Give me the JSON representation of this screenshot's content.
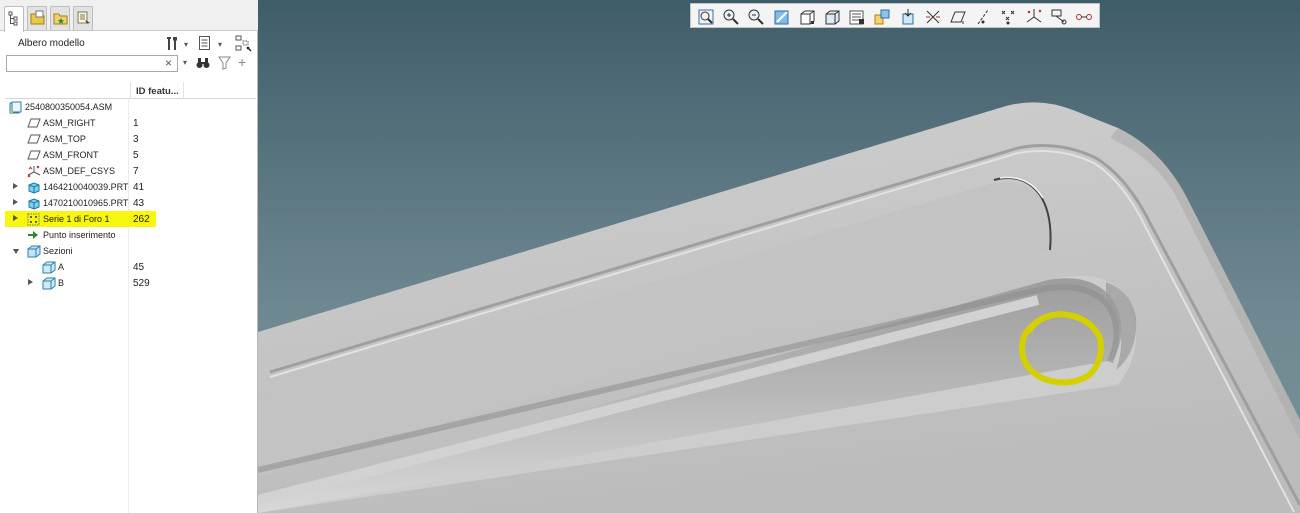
{
  "panel": {
    "tabs": [
      "model-tree-tab",
      "folder-browser-tab",
      "favorites-tab",
      "layers-tab"
    ],
    "title": "Albero modello",
    "search": {
      "value": "",
      "clear_glyph": "×"
    },
    "columns": {
      "name": "",
      "id": "ID featu..."
    }
  },
  "tree": [
    {
      "label": "2540800350054.ASM",
      "id": "",
      "icon": "assembly-icon",
      "indent": 0,
      "arrow": "none"
    },
    {
      "label": "ASM_RIGHT",
      "id": "1",
      "icon": "datum-plane-icon",
      "indent": 1,
      "arrow": "none"
    },
    {
      "label": "ASM_TOP",
      "id": "3",
      "icon": "datum-plane-icon",
      "indent": 1,
      "arrow": "none"
    },
    {
      "label": "ASM_FRONT",
      "id": "5",
      "icon": "datum-plane-icon",
      "indent": 1,
      "arrow": "none"
    },
    {
      "label": "ASM_DEF_CSYS",
      "id": "7",
      "icon": "csys-icon",
      "indent": 1,
      "arrow": "none"
    },
    {
      "label": "1464210040039.PRT",
      "id": "41",
      "icon": "part-icon",
      "indent": 1,
      "arrow": "right"
    },
    {
      "label": "1470210010965.PRT",
      "id": "43",
      "icon": "part-icon",
      "indent": 1,
      "arrow": "right"
    },
    {
      "label": "Serie 1 di Foro 1",
      "id": "262",
      "icon": "pattern-icon",
      "indent": 1,
      "arrow": "right",
      "highlight": true
    },
    {
      "label": "Punto inserimento",
      "id": "",
      "icon": "insert-arrow-icon",
      "indent": 1,
      "arrow": "none"
    },
    {
      "label": "Sezioni",
      "id": "",
      "icon": "sections-icon",
      "indent": 1,
      "arrow": "down"
    },
    {
      "label": "A",
      "id": "45",
      "icon": "section-icon",
      "indent": 2,
      "arrow": "none"
    },
    {
      "label": "B",
      "id": "529",
      "icon": "section-icon",
      "indent": 2,
      "arrow": "right"
    }
  ],
  "toolbar": [
    "zoom-fit-icon",
    "zoom-in-icon",
    "zoom-out-icon",
    "repaint-icon",
    "display-style-icon",
    "saved-orientations-icon",
    "view-manager-icon",
    "perspective-icon",
    "section-clip-icon",
    "datum-display-icon",
    "plane-display-icon",
    "axis-display-icon",
    "point-display-icon",
    "csys-display-icon",
    "annotation-display-icon",
    "spin-center-icon"
  ],
  "colors": {
    "highlight": "#f6f60f",
    "viewport_top": "#3f5d69",
    "viewport_bottom": "#7c9499",
    "model_surface": "#c7c7c7",
    "circle_markup": "#d4d000"
  }
}
